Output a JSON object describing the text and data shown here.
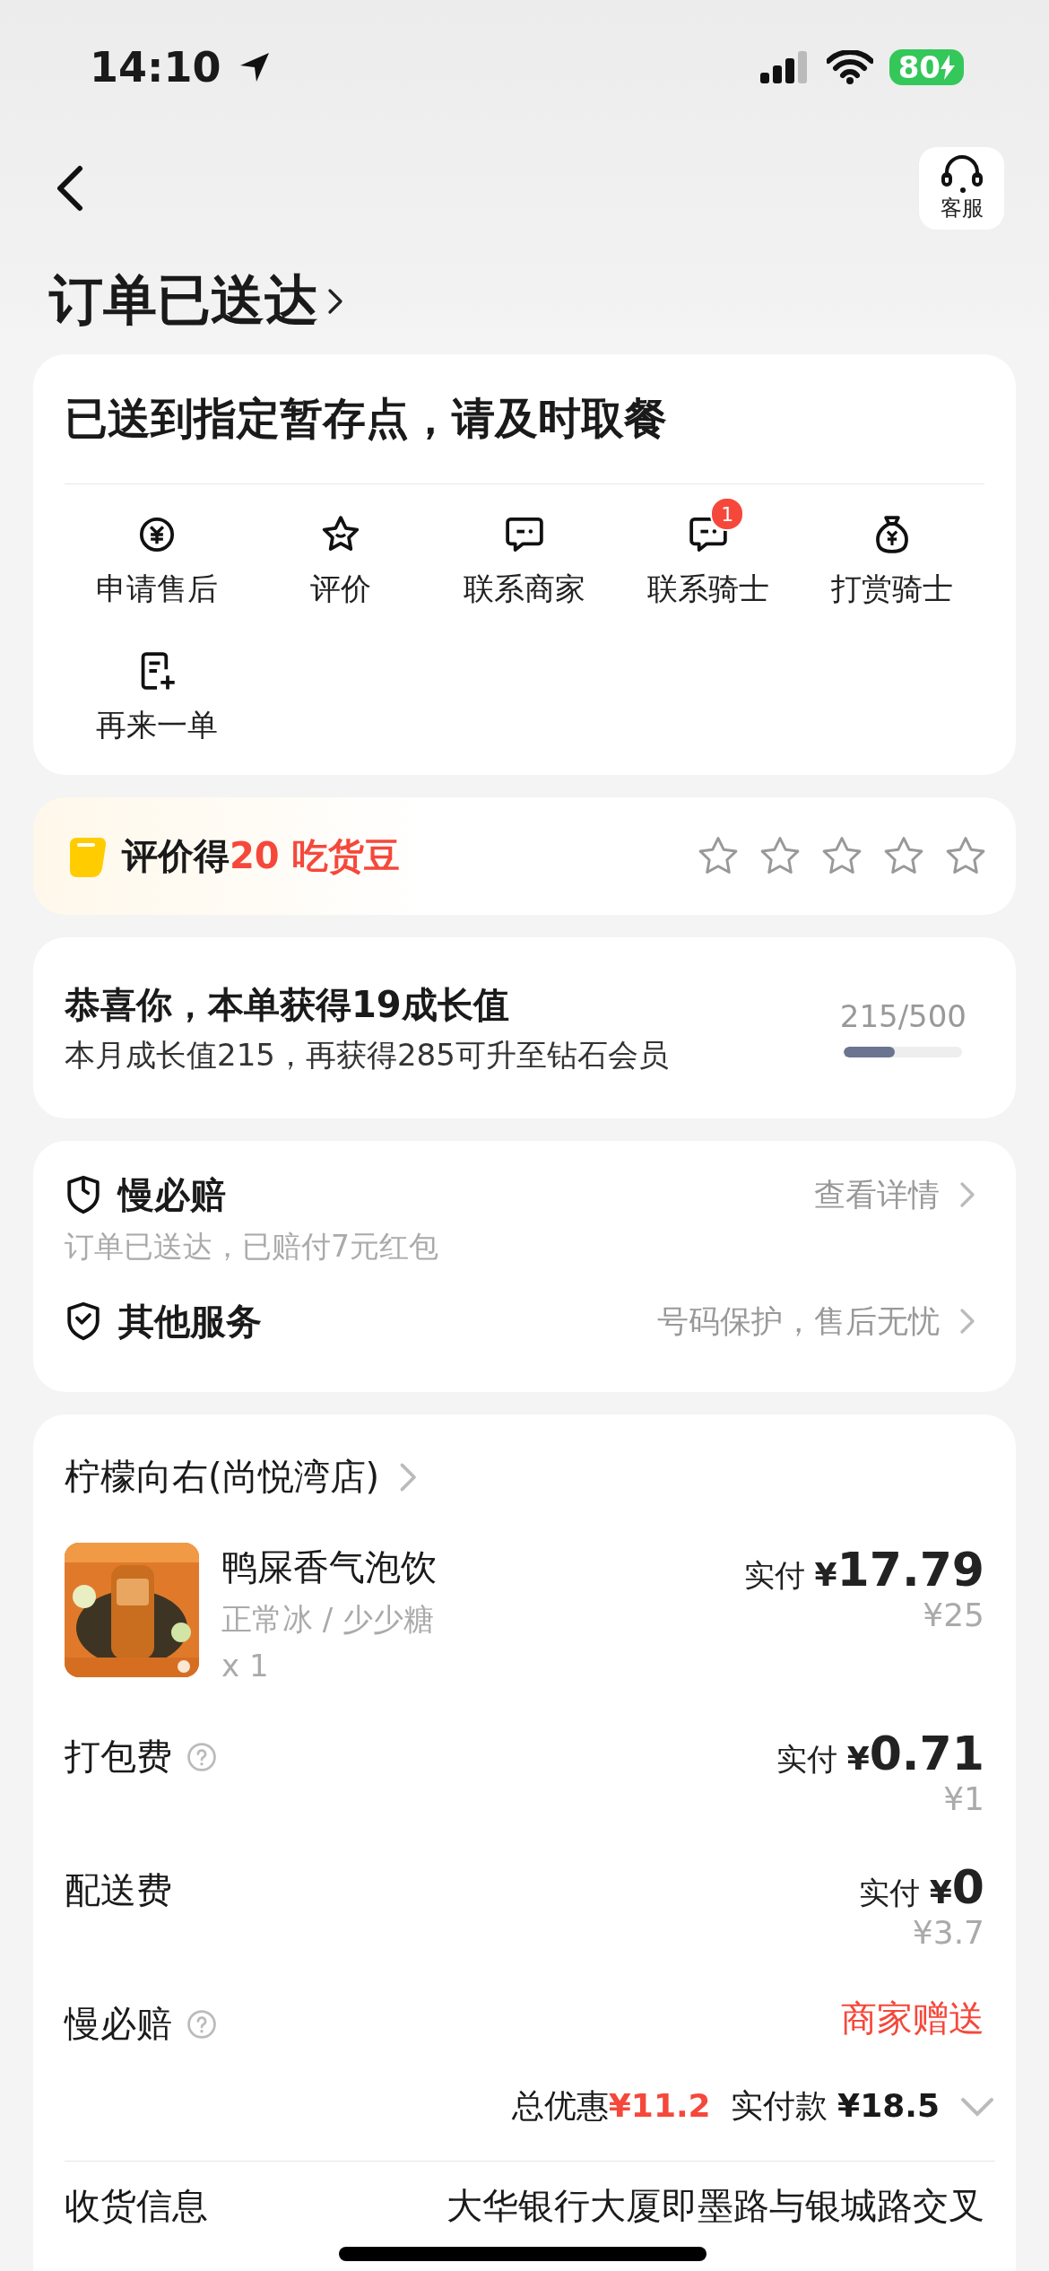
{
  "status_bar": {
    "time": "14:10",
    "battery": "80"
  },
  "header": {
    "service_label": "客服",
    "title": "订单已送达"
  },
  "delivery": {
    "message": "已送到指定暂存点，请及时取餐",
    "actions": [
      {
        "kind": "refund",
        "label": "申请售后"
      },
      {
        "kind": "review",
        "label": "评价"
      },
      {
        "kind": "chat",
        "label": "联系商家"
      },
      {
        "kind": "chat",
        "label": "联系骑士",
        "badge": "1"
      },
      {
        "kind": "tip",
        "label": "打赏骑士"
      },
      {
        "kind": "reorder",
        "label": "再来一单"
      }
    ]
  },
  "rating": {
    "prefix": "评价得",
    "reward": "20 吃货豆",
    "stars": 0
  },
  "growth": {
    "title": "恭喜你，本单获得19成长值",
    "subtitle": "本月成长值215，再获得285可升至钻石会员",
    "reading": "215/500",
    "level": 0.43
  },
  "services": [
    {
      "kind": "clock",
      "title": "慢必赔",
      "link": "查看详情",
      "note": "订单已送达，已赔付7元红包"
    },
    {
      "kind": "check",
      "title": "其他服务",
      "link": "号码保护，售后无忧"
    }
  ],
  "order": {
    "store": "柠檬向右(尚悦湾店)",
    "item": {
      "name": "鸭屎香气泡饮",
      "specs": "正常冰 / 少少糖",
      "quantity": "x 1",
      "paid_label": "实付",
      "currency": "¥",
      "price": "17.79",
      "original": "¥25"
    },
    "fees": [
      {
        "kind": "price",
        "label": "打包费",
        "help": true,
        "paid_label": "实付",
        "currency": "¥",
        "price": "0.71",
        "original": "¥1"
      },
      {
        "kind": "price",
        "label": "配送费",
        "help": false,
        "paid_label": "实付",
        "currency": "¥",
        "price": "0",
        "original": "¥3.7"
      },
      {
        "kind": "gift",
        "label": "慢必赔",
        "help": true,
        "note": "商家赠送"
      }
    ],
    "summary": {
      "discount_label": "总优惠",
      "discount_currency": "¥",
      "discount": "11.2",
      "total_label": "实付款",
      "total_currency": "¥",
      "total": "18.5"
    },
    "address": {
      "label": "收货信息",
      "value": "大华银行大厦即墨路与银城路交叉"
    }
  }
}
